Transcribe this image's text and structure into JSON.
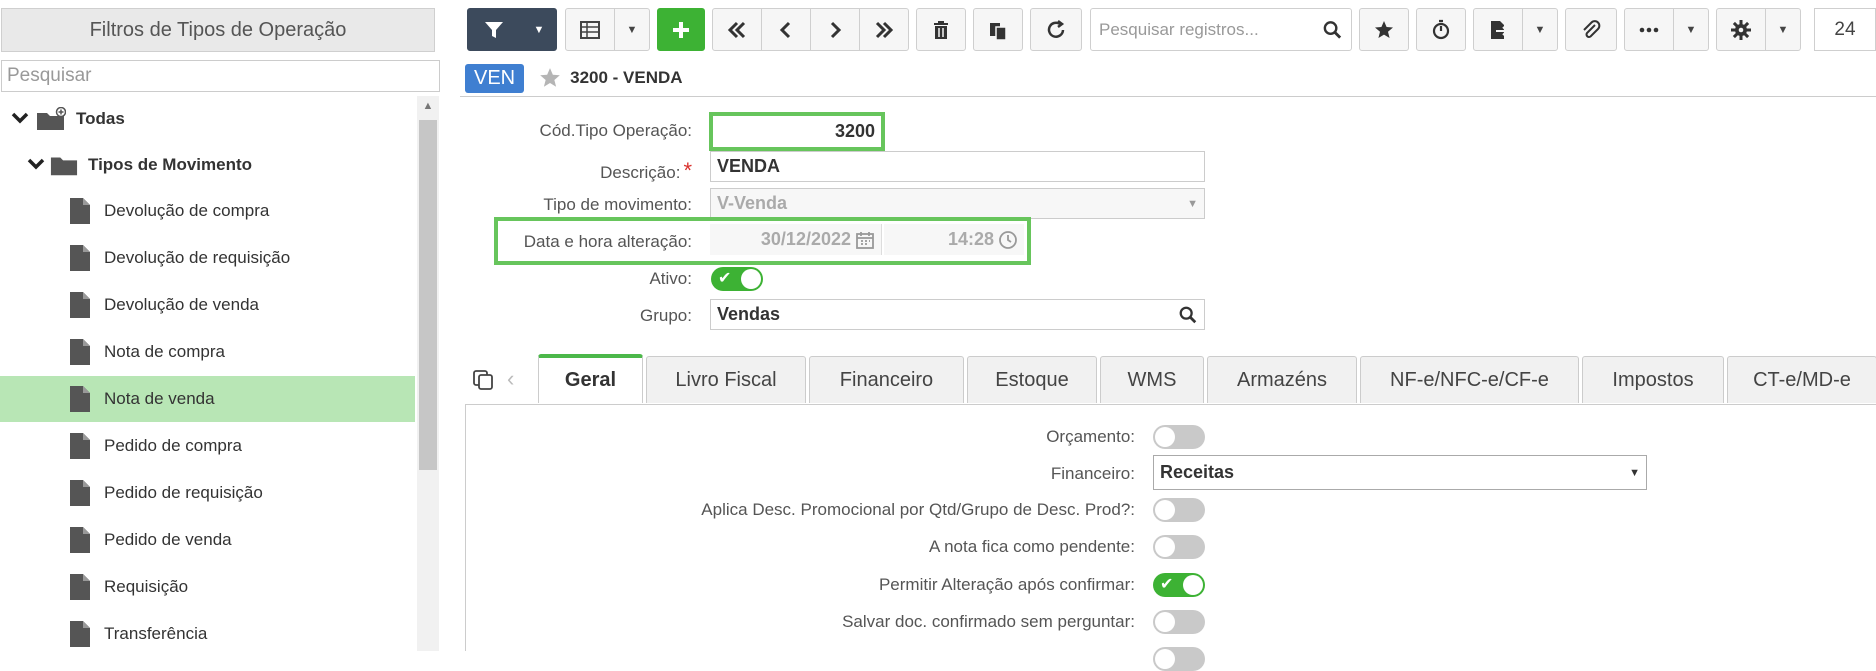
{
  "left_panel": {
    "title": "Filtros de Tipos de Operação",
    "search_placeholder": "Pesquisar",
    "root": "Todas",
    "group": "Tipos de Movimento",
    "items": [
      "Devolução de compra",
      "Devolução de requisição",
      "Devolução de venda",
      "Nota de compra",
      "Nota de venda",
      "Pedido de compra",
      "Pedido de requisição",
      "Pedido de venda",
      "Requisição",
      "Transferência"
    ],
    "selected_item": "Nota de venda"
  },
  "toolbar": {
    "search_placeholder": "Pesquisar registros...",
    "page_number": "24"
  },
  "record": {
    "badge": "VEN",
    "title": "3200 - VENDA"
  },
  "form": {
    "cod_label": "Cód.Tipo Operação:",
    "cod_value": "3200",
    "desc_label": "Descrição:",
    "desc_required": "*",
    "desc_value": "VENDA",
    "tipo_label": "Tipo de movimento:",
    "tipo_value": "V-Venda",
    "data_label": "Data e hora alteração:",
    "data_value": "30/12/2022",
    "hora_value": "14:28",
    "ativo_label": "Ativo:",
    "ativo_on": true,
    "grupo_label": "Grupo:",
    "grupo_value": "Vendas"
  },
  "tabs": [
    "Geral",
    "Livro Fiscal",
    "Financeiro",
    "Estoque",
    "WMS",
    "Armazéns",
    "NF-e/NFC-e/CF-e",
    "Impostos",
    "CT-e/MD-e"
  ],
  "active_tab": "Geral",
  "geral": {
    "orcamento_label": "Orçamento:",
    "orcamento_on": false,
    "financeiro_label": "Financeiro:",
    "financeiro_value": "Receitas",
    "aplica_label": "Aplica Desc. Promocional por Qtd/Grupo de Desc. Prod?:",
    "aplica_on": false,
    "pendente_label": "A nota fica como pendente:",
    "pendente_on": false,
    "permitir_label": "Permitir Alteração após confirmar:",
    "permitir_on": true,
    "salvar_label": "Salvar doc. confirmado sem perguntar:",
    "salvar_on": false
  },
  "colors": {
    "accent_green": "#4cb84a",
    "highlight_green": "#67c55c",
    "selected_row": "#b8e6b5",
    "badge_blue": "#3f7fd1",
    "toggle_on": "#3db234"
  }
}
